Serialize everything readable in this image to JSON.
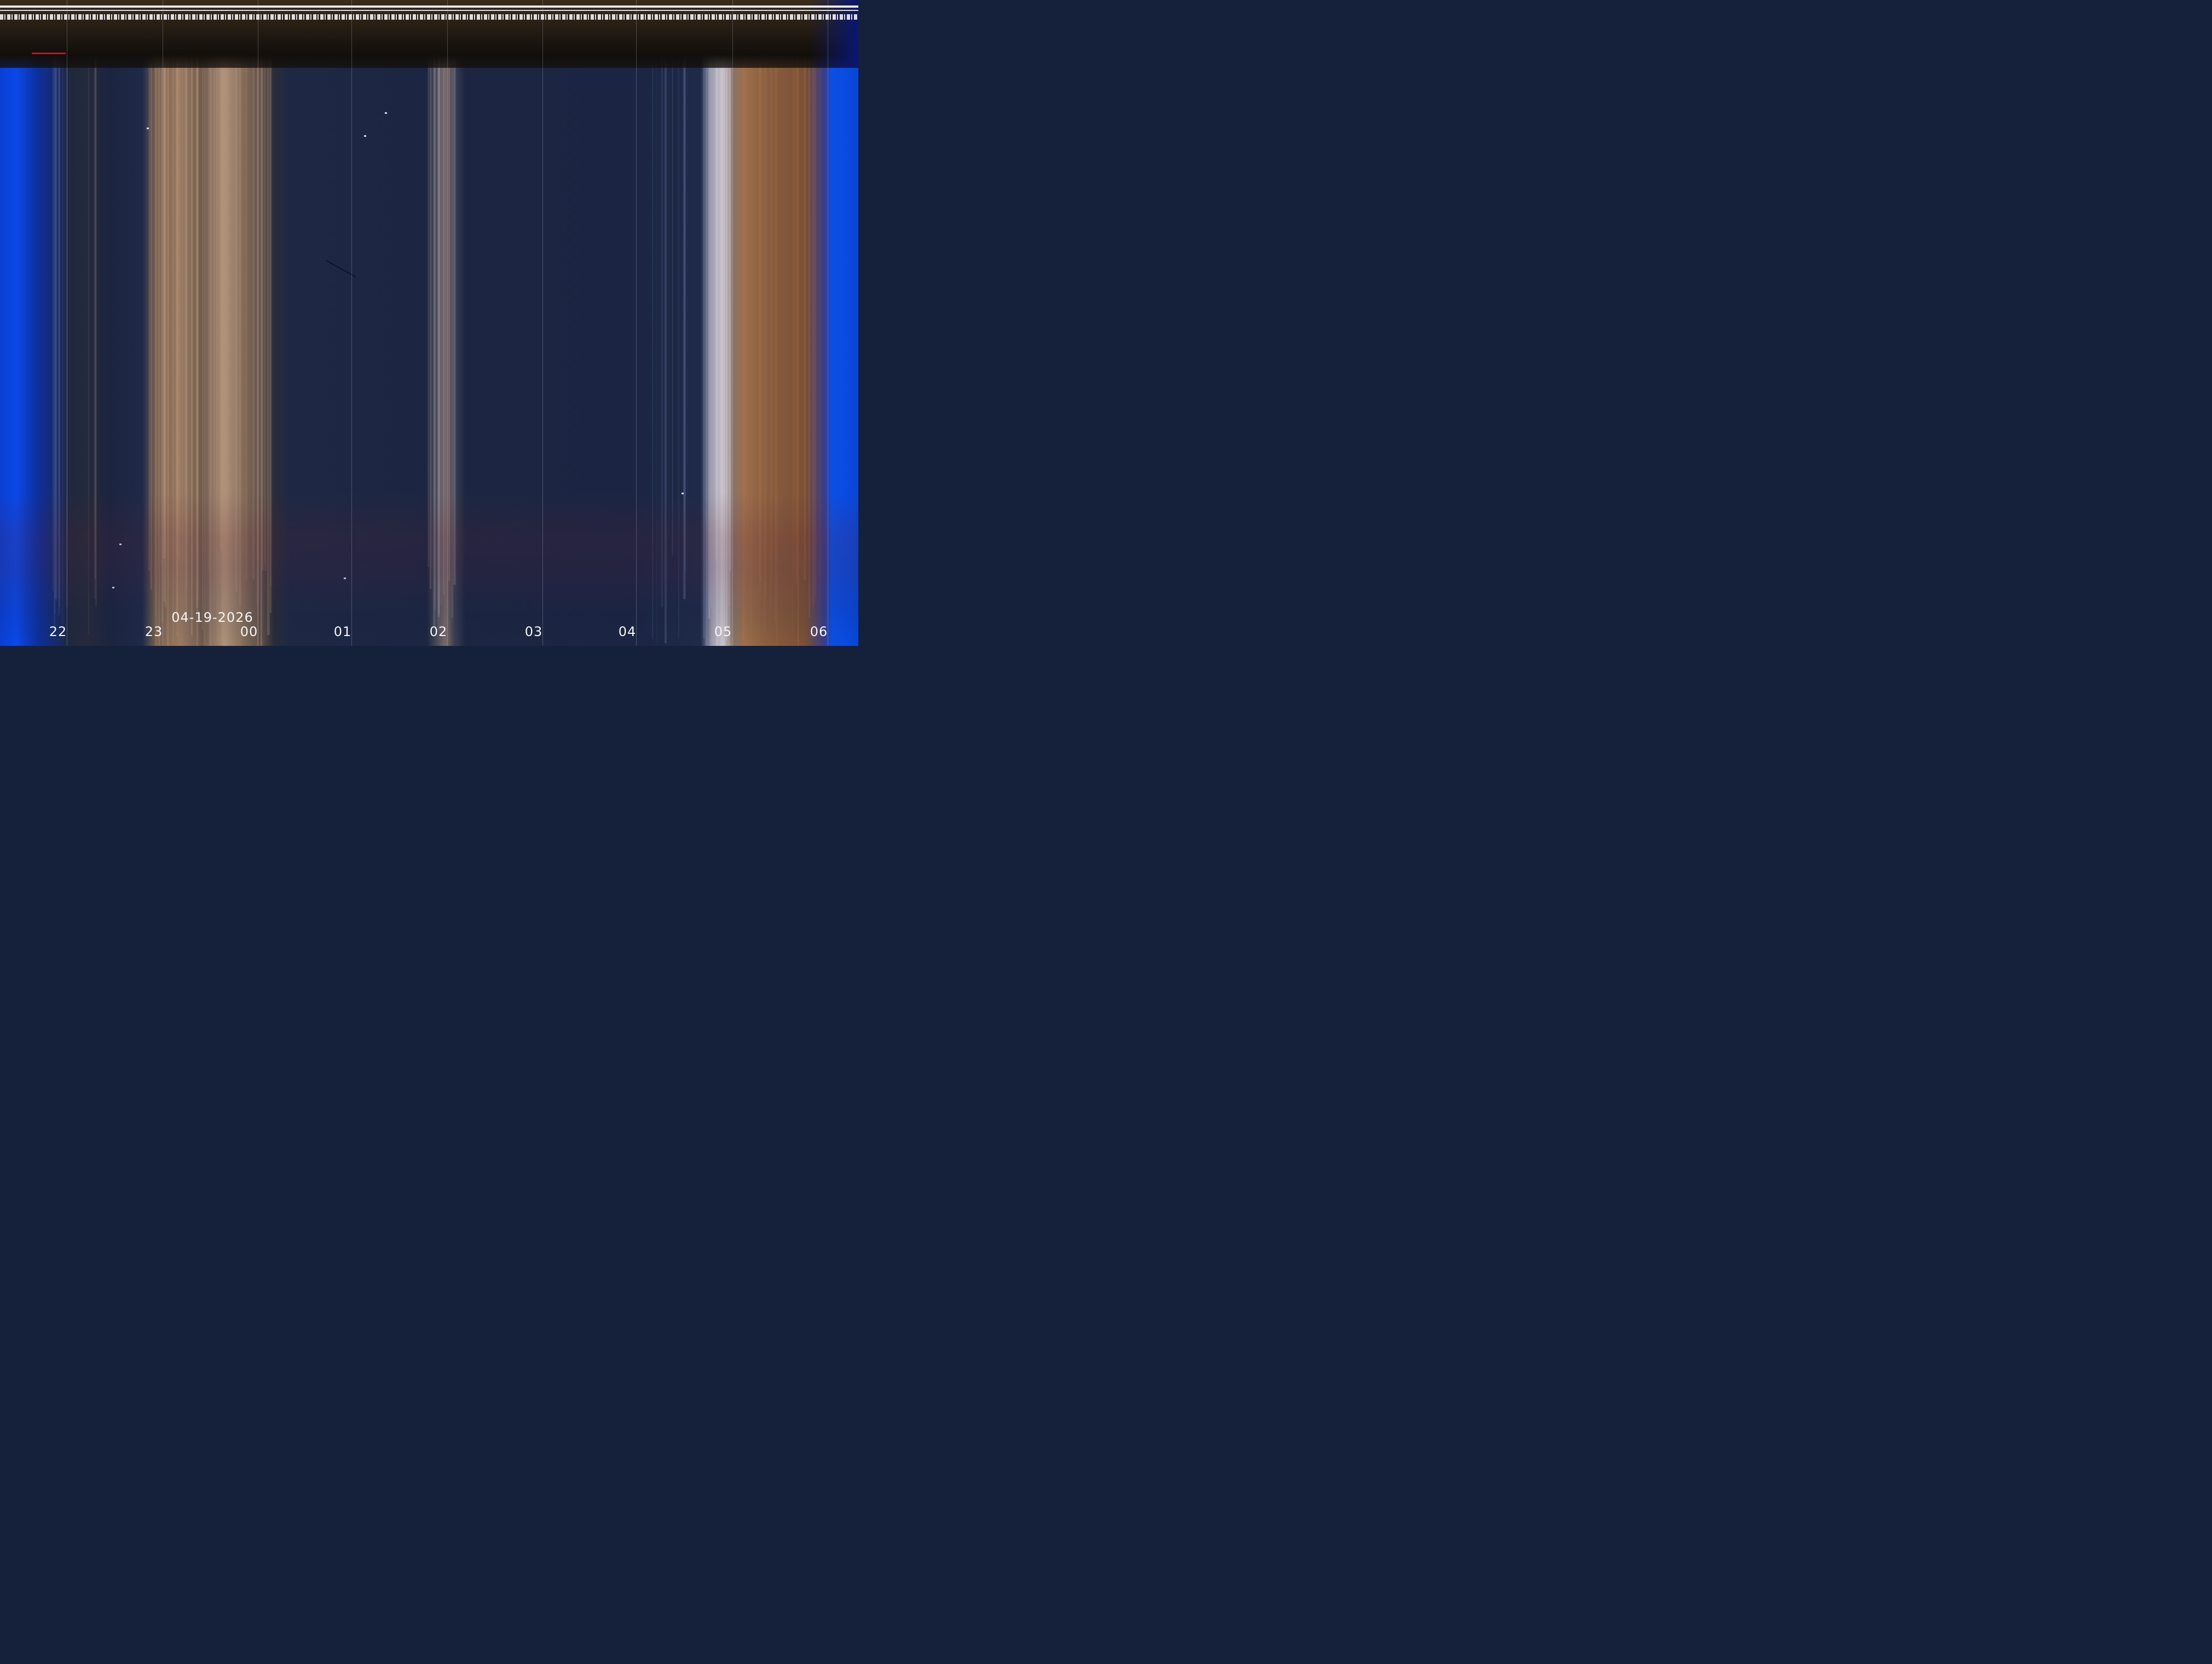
{
  "timeline": {
    "date": "04-19-2026",
    "hour_ticks": [
      "22",
      "23",
      "00",
      "01",
      "02",
      "03",
      "04",
      "05",
      "06"
    ]
  },
  "colors": {
    "twilight_blue": "#0a46d6",
    "night_sky": "#1c2642",
    "cloud_tan": "#9a7a62",
    "dawn_orange": "#8a5e40",
    "marker_red": "#c8102a"
  }
}
